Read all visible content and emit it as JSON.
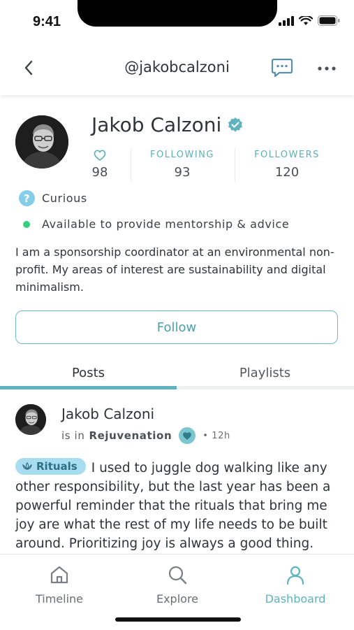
{
  "status_bar": {
    "time": "9:41"
  },
  "header": {
    "handle": "@jakobcalzoni"
  },
  "profile": {
    "name": "Jakob Calzoni",
    "stats": [
      {
        "label": "",
        "value": "98",
        "icon": "heart-outline-icon"
      },
      {
        "label": "FOLLOWING",
        "value": "93"
      },
      {
        "label": "FOLLOWERS",
        "value": "120"
      }
    ],
    "mood": "Curious",
    "availability": "Available to provide mentorship & advice",
    "bio": "I am a sponsorship coordinator at an environmental non-profit. My areas of interest are sustainability and digital minimalism.",
    "follow_label": "Follow"
  },
  "tabs": [
    {
      "label": "Posts",
      "active": true
    },
    {
      "label": "Playlists",
      "active": false
    }
  ],
  "post": {
    "author": "Jakob Calzoni",
    "in_prefix": "is in",
    "community": "Rejuvenation",
    "time": "• 12h",
    "tag": "Rituals",
    "body": "I used to juggle dog walking like any other responsibility, but the last year has been a powerful reminder that the rituals that bring me joy are what the rest of my life needs to be built around. Prioritizing joy is always a good thing."
  },
  "bottom_nav": [
    {
      "label": "Timeline",
      "icon": "home-icon",
      "active": false
    },
    {
      "label": "Explore",
      "icon": "search-icon",
      "active": false
    },
    {
      "label": "Dashboard",
      "icon": "user-icon",
      "active": true
    }
  ],
  "colors": {
    "accent": "#5fb3bf",
    "available_dot": "#35d07f",
    "tag_pill": "#a8dcf0"
  }
}
